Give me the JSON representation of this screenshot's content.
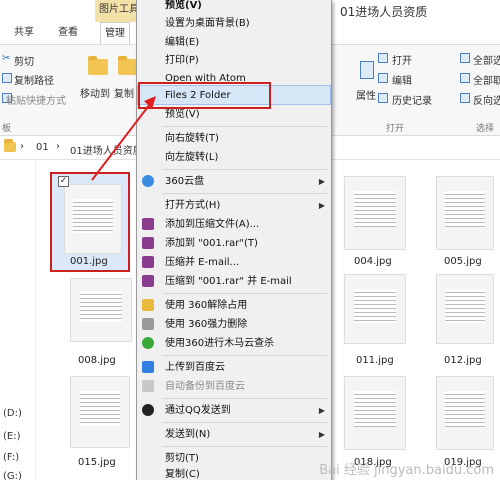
{
  "ribbon": {
    "contextual_tab": "图片工具",
    "window_title": "01进场人员资质",
    "tabs": [
      "共享",
      "查看",
      "管理"
    ],
    "clipboard": {
      "cut": "剪切",
      "copy_path": "复制路径",
      "paste_shortcut": "粘贴快捷方式",
      "group": "板"
    },
    "organize": {
      "move_to": "移动到",
      "copy_to": "复制"
    },
    "open": {
      "open": "打开",
      "edit": "编辑",
      "history": "历史记录",
      "properties": "属性",
      "group": "打开"
    },
    "select": {
      "all": "全部选",
      "none": "全部取",
      "invert": "反向选",
      "group": "选择"
    }
  },
  "address": {
    "crumbs": [
      "01",
      "01进场人员资质"
    ]
  },
  "drives": [
    "(D:)",
    "(E:)",
    "(F:)",
    "(G:)"
  ],
  "files": {
    "selected": "001.jpg",
    "items": [
      "004.jpg",
      "005.jpg",
      "008.jpg",
      "011.jpg",
      "012.jpg",
      "015.jpg",
      "018.jpg",
      "019.jpg"
    ]
  },
  "context_menu": {
    "items": [
      {
        "label": "预览(V)",
        "bold": true
      },
      {
        "label": "设置为桌面背景(B)"
      },
      {
        "label": "编辑(E)"
      },
      {
        "label": "打印(P)"
      },
      {
        "label": "Open with Atom"
      },
      {
        "label": "Files 2 Folder"
      },
      {
        "label": "预览(V)"
      },
      {
        "label": "向右旋转(T)"
      },
      {
        "label": "向左旋转(L)"
      },
      {
        "label": "360云盘",
        "submenu": true
      },
      {
        "label": "打开方式(H)",
        "submenu": true
      },
      {
        "label": "添加到压缩文件(A)..."
      },
      {
        "label": "添加到 \"001.rar\"(T)"
      },
      {
        "label": "压缩并 E-mail..."
      },
      {
        "label": "压缩到 \"001.rar\" 并 E-mail"
      },
      {
        "label": "使用 360解除占用"
      },
      {
        "label": "使用 360强力删除"
      },
      {
        "label": "使用360进行木马云查杀"
      },
      {
        "label": "上传到百度云"
      },
      {
        "label": "自动备份到百度云",
        "disabled": true
      },
      {
        "label": "通过QQ发送到",
        "submenu": true
      },
      {
        "label": "发送到(N)",
        "submenu": true
      },
      {
        "label": "剪切(T)"
      },
      {
        "label": "复制(C)"
      }
    ]
  },
  "watermark": "Bai 经验 jingyan.baidu.com",
  "colors": {
    "highlight_red": "#cc1f1f",
    "menu_hover": "#d6e6f7",
    "folder": "#f1c453"
  }
}
